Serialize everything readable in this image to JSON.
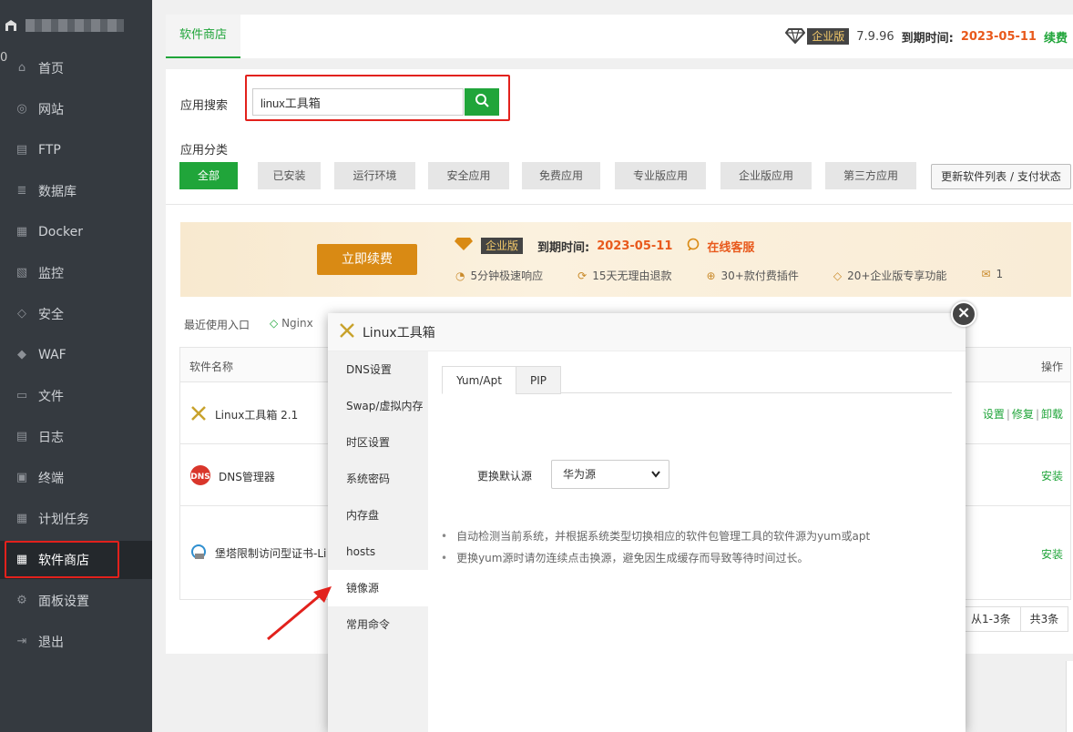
{
  "sidebar": {
    "badge": "0",
    "items": [
      {
        "label": "首页",
        "icon": "home-icon",
        "glyph": "⌂"
      },
      {
        "label": "网站",
        "icon": "globe-icon",
        "glyph": "◎"
      },
      {
        "label": "FTP",
        "icon": "ftp-icon",
        "glyph": "▤"
      },
      {
        "label": "数据库",
        "icon": "database-icon",
        "glyph": "≣"
      },
      {
        "label": "Docker",
        "icon": "docker-icon",
        "glyph": "▦"
      },
      {
        "label": "监控",
        "icon": "monitor-icon",
        "glyph": "▧"
      },
      {
        "label": "安全",
        "icon": "shield-icon",
        "glyph": "◇"
      },
      {
        "label": "WAF",
        "icon": "waf-shield-icon",
        "glyph": "◆"
      },
      {
        "label": "文件",
        "icon": "folder-icon",
        "glyph": "▭"
      },
      {
        "label": "日志",
        "icon": "log-icon",
        "glyph": "▤"
      },
      {
        "label": "终端",
        "icon": "terminal-icon",
        "glyph": "▣"
      },
      {
        "label": "计划任务",
        "icon": "calendar-icon",
        "glyph": "▦"
      },
      {
        "label": "软件商店",
        "icon": "apps-grid-icon",
        "glyph": "▦"
      },
      {
        "label": "面板设置",
        "icon": "gear-icon",
        "glyph": "⚙"
      },
      {
        "label": "退出",
        "icon": "logout-icon",
        "glyph": "⇥"
      }
    ],
    "active_index": 12
  },
  "topbar": {
    "tab": "软件商店",
    "edition": "企业版",
    "version": "7.9.96",
    "expire_label": "到期时间:",
    "expire_date": "2023-05-11",
    "renew": "续费"
  },
  "search": {
    "label": "应用搜索",
    "value": "linux工具箱"
  },
  "category": {
    "label": "应用分类",
    "items": [
      "全部",
      "已安装",
      "运行环境",
      "安全应用",
      "免费应用",
      "专业版应用",
      "企业版应用",
      "第三方应用"
    ],
    "active_index": 0,
    "update_button": "更新软件列表 / 支付状态"
  },
  "banner": {
    "buy_button": "立即续费",
    "edition": "企业版",
    "expire_label": "到期时间:",
    "expire_date": "2023-05-11",
    "service": "在线客服",
    "features": [
      "5分钟极速响应",
      "15天无理由退款",
      "30+款付费插件",
      "20+企业版专享功能",
      "1"
    ]
  },
  "recent": {
    "label": "最近使用入口",
    "items": [
      "Nginx"
    ]
  },
  "table": {
    "header_name": "软件名称",
    "header_op": "操作",
    "rows": [
      {
        "name": "Linux工具箱 2.1",
        "ops": [
          "设置",
          "修复",
          "卸载"
        ]
      },
      {
        "name": "DNS管理器",
        "ops": [
          "安装"
        ]
      },
      {
        "name": "堡塔限制访问型证书-Li",
        "ops": [
          "安装"
        ]
      }
    ],
    "pager": [
      "从1-3条",
      "共3条"
    ]
  },
  "dialog": {
    "title": "Linux工具箱",
    "menu": [
      "DNS设置",
      "Swap/虚拟内存",
      "时区设置",
      "系统密码",
      "内存盘",
      "hosts",
      "镜像源",
      "常用命令"
    ],
    "active_menu_index": 6,
    "tabs": [
      "Yum/Apt",
      "PIP"
    ],
    "active_tab_index": 0,
    "source_label": "更换默认源",
    "source_value": "华为源",
    "tips": [
      "自动检测当前系统，并根据系统类型切换相应的软件包管理工具的软件源为yum或apt",
      "更换yum源时请勿连续点击换源，避免因生成缓存而导致等待时间过长。"
    ]
  },
  "colors": {
    "accent": "#20a53a",
    "highlight": "#e2211c",
    "orange": "#e8591c"
  }
}
